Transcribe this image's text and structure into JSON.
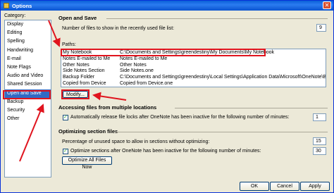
{
  "window": {
    "title": "Options",
    "close_glyph": "✕"
  },
  "category": {
    "label": "Category:",
    "items": [
      "Display",
      "Editing",
      "Spelling",
      "Handwriting",
      "E-mail",
      "Note Flags",
      "Audio and Video",
      "Shared Session",
      "Open and Save",
      "Backup",
      "Security",
      "Other"
    ],
    "selected": "Open and Save"
  },
  "open_save": {
    "title": "Open and Save",
    "recent_files_label": "Number of files to show in the recently used file list:",
    "recent_files_value": "9",
    "paths_label": "Paths:",
    "paths": [
      {
        "name": "My Notebook",
        "value": "C:\\Documents and Settings\\greendestiny\\My Documents\\My Notebook"
      },
      {
        "name": "Notes E-mailed to Me",
        "value": "Notes E-mailed to Me"
      },
      {
        "name": "Other Notes",
        "value": "Other Notes"
      },
      {
        "name": "Side Notes Section",
        "value": "Side Notes.one"
      },
      {
        "name": "Backup Folder",
        "value": "C:\\Documents and Settings\\greendestiny\\Local Settings\\Application Data\\Microsoft\\OneNote\\Backup"
      },
      {
        "name": "Copied from Device",
        "value": "Copied from Device.one"
      }
    ],
    "modify_label": "Modify..."
  },
  "accessing": {
    "title": "Accessing files from multiple locations",
    "release_lock_label": "Automatically release file locks after OneNote has been inactive for the following number of minutes:",
    "release_lock_checked": true,
    "release_lock_value": "1"
  },
  "optimizing": {
    "title": "Optimizing section files",
    "unused_space_label": "Percentage of unused space to allow in sections without optimizing:",
    "unused_space_value": "15",
    "optimize_label": "Optimize sections after OneNote has been inactive for the following number of minutes:",
    "optimize_checked": true,
    "optimize_value": "30",
    "optimize_all_label": "Optimize All Files Now"
  },
  "footer": {
    "ok": "OK",
    "cancel": "Cancel",
    "apply": "Apply"
  },
  "colors": {
    "highlight": "#e0141e",
    "selection": "#316ac5",
    "title_bar": "#0a5fd8"
  }
}
